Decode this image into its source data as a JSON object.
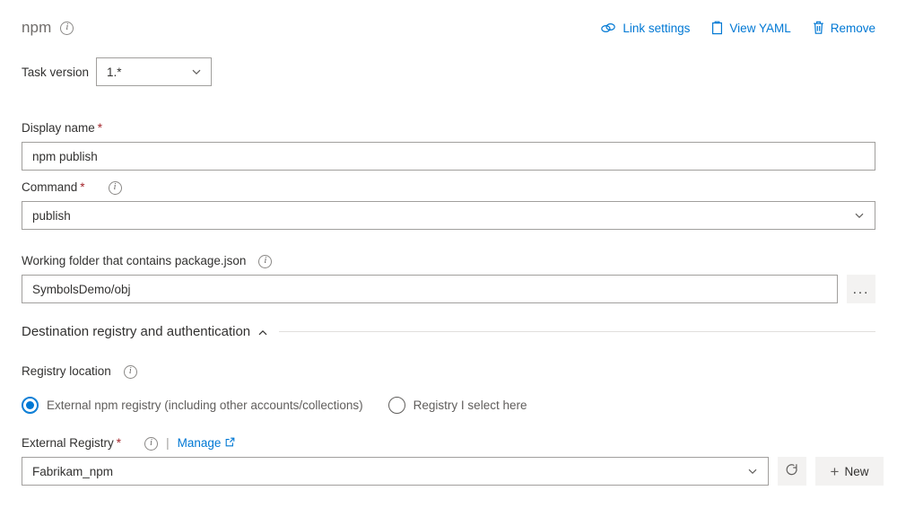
{
  "header": {
    "task_title": "npm",
    "info_icon": "info-icon",
    "actions": [
      {
        "label": "Link settings",
        "icon": "link-icon"
      },
      {
        "label": "View YAML",
        "icon": "clipboard-icon"
      },
      {
        "label": "Remove",
        "icon": "trash-icon"
      }
    ]
  },
  "task_version": {
    "label": "Task version",
    "value": "1.*",
    "chevron_icon": "chevron-down-icon"
  },
  "display_name": {
    "label": "Display name",
    "required_mark": "*",
    "value": "npm publish"
  },
  "command": {
    "label": "Command",
    "required_mark": "*",
    "info_icon": "info-icon",
    "value": "publish",
    "chevron_icon": "chevron-down-icon"
  },
  "working_folder": {
    "label": "Working folder that contains package.json",
    "info_icon": "info-icon",
    "value": "SymbolsDemo/obj",
    "browse_label": "...",
    "browse_icon": "ellipsis-icon"
  },
  "section": {
    "title": "Destination registry and authentication",
    "collapse_icon": "chevron-up-icon"
  },
  "registry_location": {
    "label": "Registry location",
    "info_icon": "info-icon",
    "options": [
      {
        "label": "External npm registry (including other accounts/collections)",
        "selected": true
      },
      {
        "label": "Registry I select here",
        "selected": false
      }
    ]
  },
  "external_registry": {
    "label": "External Registry",
    "required_mark": "*",
    "info_icon": "info-icon",
    "separator": "|",
    "manage_label": "Manage",
    "manage_icon": "external-link-icon",
    "value": "Fabrikam_npm",
    "chevron_icon": "chevron-down-icon",
    "refresh_icon": "refresh-icon",
    "new_label": "New",
    "new_icon": "plus-icon"
  },
  "colors": {
    "accent": "#0078d4",
    "required": "#a4262c",
    "border": "#a19f9d",
    "button_bg": "#f3f2f1",
    "text": "#323130",
    "muted": "#605e5c"
  }
}
